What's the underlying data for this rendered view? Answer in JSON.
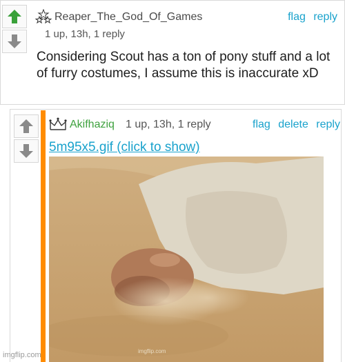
{
  "comment1": {
    "username": "Reaper_The_God_Of_Games",
    "meta": "1 up, 13h, 1 reply",
    "actions": [
      "flag",
      "reply"
    ],
    "text": "Considering Scout has a ton of pony stuff and a lot of furry costumes, I assume this is inaccurate xD",
    "upvoted": true,
    "badge_icon": "stars-icon"
  },
  "comment2": {
    "username": "Akifhaziq",
    "meta": "1 up, 13h, 1 reply",
    "actions": [
      "flag",
      "delete",
      "reply"
    ],
    "link_text": "5m95x5.gif (click to show)",
    "badge_icon": "crown-icon"
  },
  "watermark": "imgflip.com",
  "gif_watermark": "imgflip.com",
  "colors": {
    "accent": "#19a2cc",
    "upvote_green": "#3aa13a",
    "reply_bar": "#ff8c00",
    "username_green": "#3ea13e"
  }
}
